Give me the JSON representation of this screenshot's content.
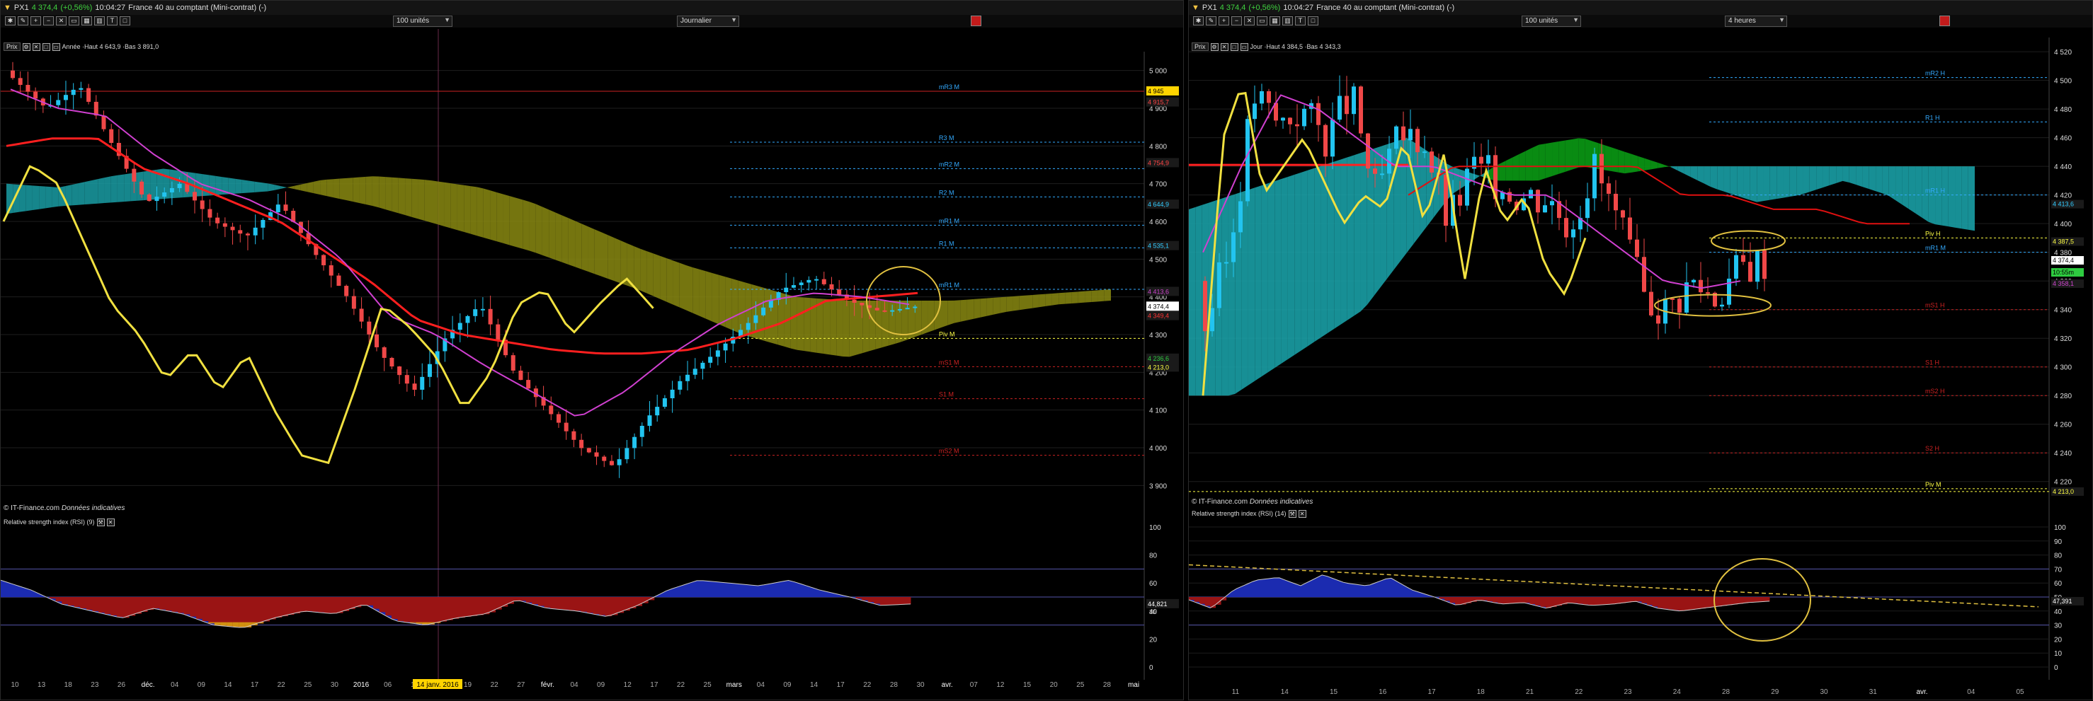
{
  "left": {
    "title": {
      "instrument": "PX1",
      "last": "4 374,4",
      "change": "(+0,56%)",
      "time": "10:04:27",
      "name": "France 40 au comptant (Mini-contrat) (-)"
    },
    "units": "100 unités",
    "period": "Journalier",
    "price_head": {
      "tag": "Prix",
      "info": "Année ·Haut 4 643,9 ·Bas 3 891,0"
    },
    "rsi_head": "Relative strength index (RSI) (9)",
    "stamp": {
      "a": "© IT-Finance.com",
      "b": "Données indicatives"
    },
    "date_marker": "14 janv. 2016",
    "xlabels": [
      "10",
      "13",
      "18",
      "23",
      "26",
      "déc.",
      "04",
      "09",
      "14",
      "17",
      "22",
      "25",
      "30",
      "2016",
      "06",
      "11",
      "14",
      "19",
      "22",
      "27",
      "févr.",
      "04",
      "09",
      "12",
      "17",
      "22",
      "25",
      "mars",
      "04",
      "09",
      "14",
      "17",
      "22",
      "28",
      "30",
      "avr.",
      "07",
      "12",
      "15",
      "20",
      "25",
      "28",
      "mai"
    ],
    "yticks": [
      "5 000",
      "4 900",
      "4 800",
      "4 700",
      "4 600",
      "4 500",
      "4 400",
      "4 300",
      "4 200",
      "4 100",
      "4 000",
      "3 900"
    ],
    "rsi_ticks": [
      "100",
      "80",
      "60",
      "40",
      "20",
      "0"
    ],
    "rsi_value": "44,821",
    "rsi_value_sub": "30",
    "price_tags": [
      {
        "text": "4 945",
        "color": "#ffd400",
        "fg": "#000"
      },
      {
        "text": "4 915,7",
        "color": "#1a1a1a",
        "fg": "#ff4444"
      },
      {
        "text": "4 754,9",
        "color": "#1a1a1a",
        "fg": "#ff4444"
      },
      {
        "text": "4 644,9",
        "color": "#1a1a1a",
        "fg": "#33ccff"
      },
      {
        "text": "4 535,1",
        "color": "#1a1a1a",
        "fg": "#33ccff"
      },
      {
        "text": "4 413,6",
        "color": "#1a1a1a",
        "fg": "#cc44cc"
      },
      {
        "text": "4 374,4",
        "color": "#ffffff",
        "fg": "#000"
      },
      {
        "text": "4 349,4",
        "color": "#1a1a1a",
        "fg": "#ff3333"
      },
      {
        "text": "4 236,6",
        "color": "#1a1a1a",
        "fg": "#2ecc40"
      },
      {
        "text": "4 213,0",
        "color": "#1a1a1a",
        "fg": "#ffff44"
      }
    ],
    "pivots": [
      {
        "label": "mR3 M",
        "color": "#33aaff"
      },
      {
        "label": "R3 M",
        "color": "#33aaff"
      },
      {
        "label": "mR2 M",
        "color": "#33aaff"
      },
      {
        "label": "R2 M",
        "color": "#33aaff"
      },
      {
        "label": "mR1 M",
        "color": "#33aaff"
      },
      {
        "label": "R1 M",
        "color": "#33aaff"
      },
      {
        "label": "mR1 M",
        "color": "#33aaff"
      },
      {
        "label": "Piv M",
        "color": "#ffff44"
      },
      {
        "label": "mS1 M",
        "color": "#cc2222"
      },
      {
        "label": "S1 M",
        "color": "#cc2222"
      },
      {
        "label": "mS2 M",
        "color": "#cc2222"
      }
    ]
  },
  "right": {
    "title": {
      "instrument": "PX1",
      "last": "4 374,4",
      "change": "(+0,56%)",
      "time": "10:04:27",
      "name": "France 40 au comptant (Mini-contrat) (-)"
    },
    "units": "100 unités",
    "period": "4 heures",
    "price_head": {
      "tag": "Prix",
      "info": "Jour ·Haut 4 384,5 ·Bas 4 343,3"
    },
    "rsi_head": "Relative strength index (RSI) (14)",
    "stamp": {
      "a": "© IT-Finance.com",
      "b": "Données indicatives"
    },
    "xlabels": [
      "11",
      "14",
      "15",
      "16",
      "17",
      "18",
      "21",
      "22",
      "23",
      "24",
      "28",
      "29",
      "30",
      "31",
      "avr.",
      "04",
      "05"
    ],
    "yticks": [
      "4 520",
      "4 500",
      "4 480",
      "4 460",
      "4 440",
      "4 420",
      "4 400",
      "4 380",
      "4 360",
      "4 340",
      "4 320",
      "4 300",
      "4 280",
      "4 260",
      "4 240",
      "4 220"
    ],
    "rsi_ticks": [
      "100",
      "90",
      "80",
      "70",
      "60",
      "50",
      "40",
      "30",
      "20",
      "10",
      "0"
    ],
    "rsi_value": "47,391",
    "price_tags": [
      {
        "text": "4 413,6",
        "color": "#1a1a1a",
        "fg": "#33ccff"
      },
      {
        "text": "4 387,5",
        "color": "#1a1a1a",
        "fg": "#ffff44"
      },
      {
        "text": "4 374,4",
        "color": "#ffffff",
        "fg": "#000"
      },
      {
        "text": "10:55m",
        "color": "#2ecc40",
        "fg": "#000"
      },
      {
        "text": "4 358,1",
        "color": "#1a1a1a",
        "fg": "#cc44cc"
      },
      {
        "text": "4 213,0",
        "color": "#1a1a1a",
        "fg": "#ffff44"
      }
    ],
    "pivots": [
      {
        "label": "mR2 H",
        "color": "#33aaff"
      },
      {
        "label": "R1 H",
        "color": "#33aaff"
      },
      {
        "label": "mR1 H",
        "color": "#33aaff"
      },
      {
        "label": "Piv H",
        "color": "#ffff44"
      },
      {
        "label": "mR1 M",
        "color": "#33aaff"
      },
      {
        "label": "mS1 H",
        "color": "#cc2222"
      },
      {
        "label": "S1 H",
        "color": "#cc2222"
      },
      {
        "label": "mS2 H",
        "color": "#cc2222"
      },
      {
        "label": "S2 H",
        "color": "#cc2222"
      },
      {
        "label": "Piv M",
        "color": "#ffff44"
      }
    ]
  },
  "chart_data": [
    {
      "type": "candlestick",
      "title": "France 40 au comptant (Mini-contrat) - Journalier",
      "ylim": [
        3850,
        5050
      ],
      "x": [
        "2015-11-10",
        "2015-12-01",
        "2016-01-04",
        "2016-02-01",
        "2016-03-01",
        "2016-03-28"
      ],
      "close_approx": [
        4950,
        4600,
        4450,
        4150,
        4330,
        4374.4
      ],
      "overlays": [
        "Ichimoku cloud",
        "Kijun (red)",
        "Tenkan (magenta)",
        "Chikou (yellow)"
      ]
    },
    {
      "type": "area",
      "title": "Relative strength index (RSI) (9)",
      "ylim": [
        0,
        100
      ],
      "last": 44.821
    },
    {
      "type": "candlestick",
      "title": "France 40 au comptant (Mini-contrat) - 4 heures",
      "ylim": [
        4210,
        4525
      ],
      "x": [
        "03-11",
        "03-17",
        "03-23",
        "03-29"
      ],
      "close_approx": [
        4340,
        4440,
        4380,
        4374.4
      ]
    },
    {
      "type": "area",
      "title": "Relative strength index (RSI) (14)",
      "ylim": [
        0,
        100
      ],
      "last": 47.391
    }
  ]
}
